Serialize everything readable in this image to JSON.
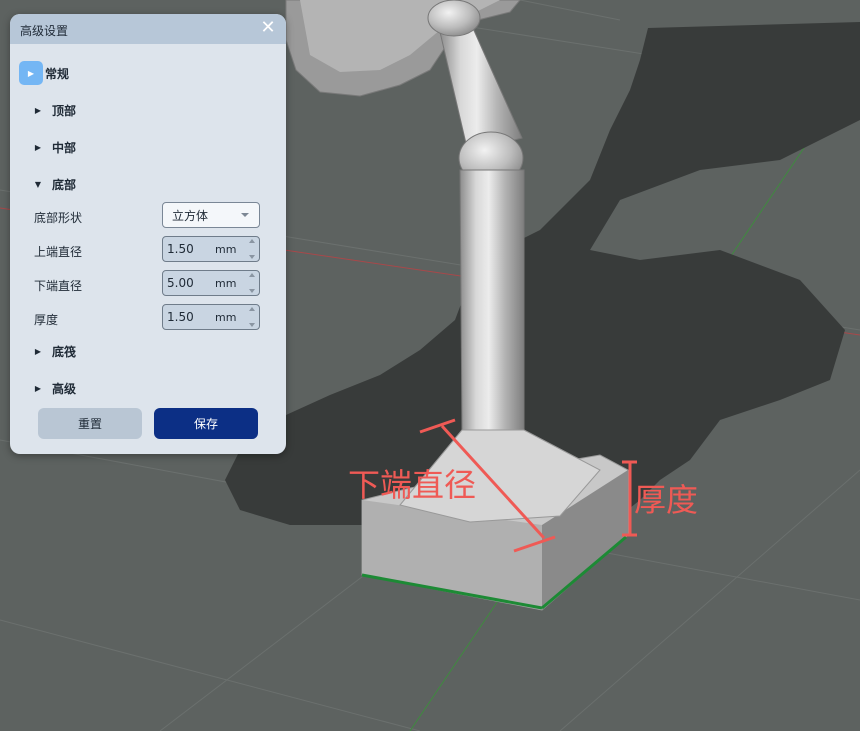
{
  "panel": {
    "title": "高级设置",
    "close_glyph": "✕",
    "sections": {
      "general": "常规",
      "top": "顶部",
      "middle": "中部",
      "bottom": "底部",
      "bottom_brim": "底筏",
      "advanced": "高级"
    },
    "bottom": {
      "shape_label": "底部形状",
      "shape_value": "立方体",
      "upper_diameter_label": "上端直径",
      "upper_diameter_value": "1.50",
      "lower_diameter_label": "下端直径",
      "lower_diameter_value": "5.00",
      "thickness_label": "厚度",
      "thickness_value": "1.50",
      "unit": "mm"
    },
    "reset_label": "重置",
    "save_label": "保存"
  },
  "annotations": {
    "lower_diameter": "下端直径",
    "thickness": "厚度"
  },
  "colors": {
    "annotation": "#ef5a55",
    "save_button": "#0c2f85",
    "active_section": "#74b6f4",
    "axis_x": "#b0484a",
    "axis_y": "#3d8f3f",
    "shadow": "#383b3a"
  },
  "icons": {
    "close": "close-icon",
    "expanded": "chevron-down-icon",
    "collapsed": "chevron-right-icon"
  }
}
